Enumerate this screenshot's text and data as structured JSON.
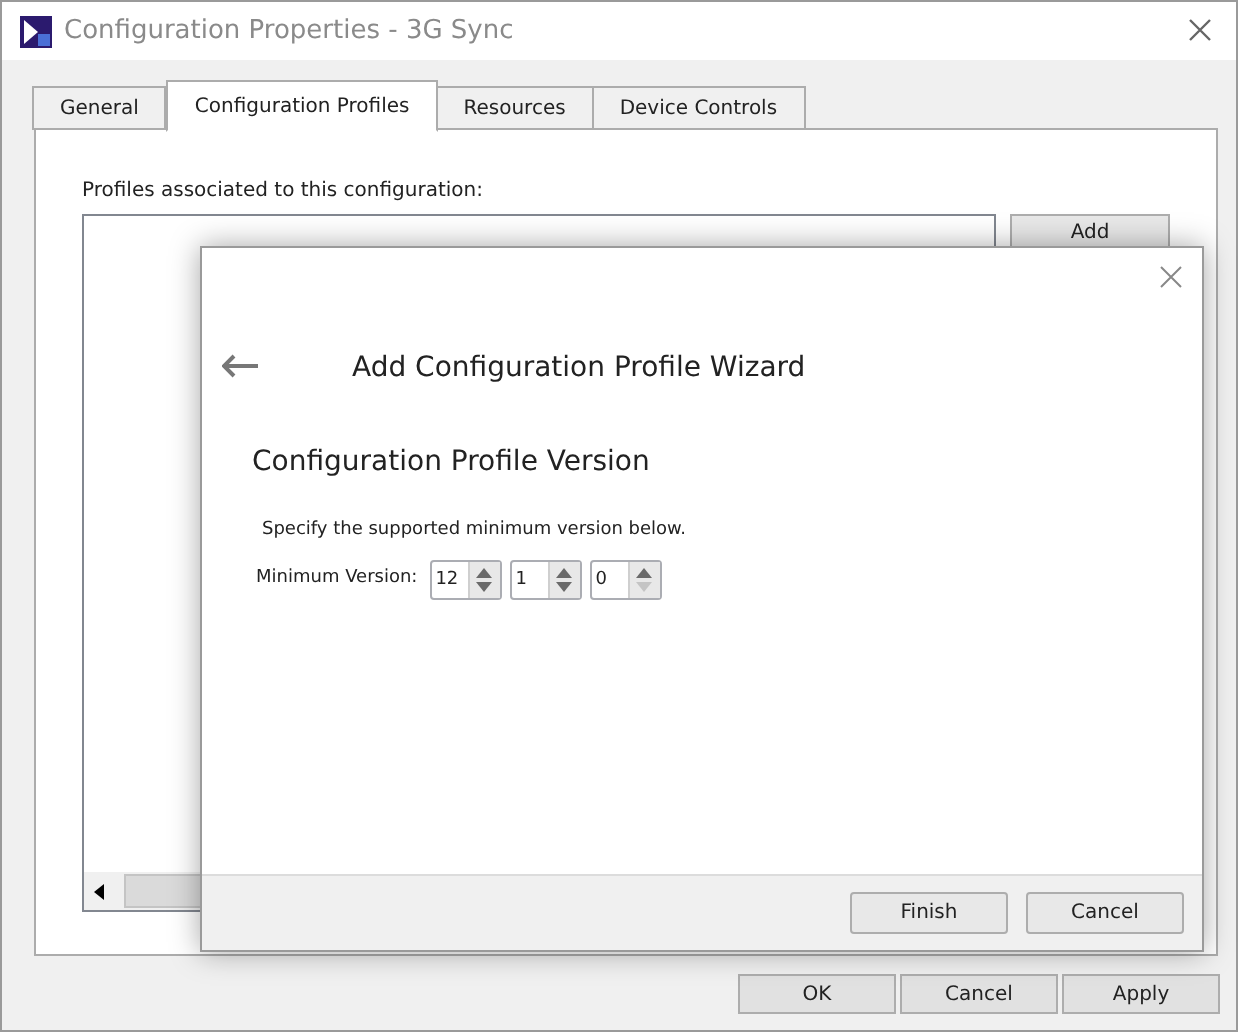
{
  "window": {
    "title": "Configuration Properties - 3G Sync"
  },
  "tabs": [
    {
      "label": "General",
      "selected": false
    },
    {
      "label": "Configuration Profiles",
      "selected": true
    },
    {
      "label": "Resources",
      "selected": false
    },
    {
      "label": "Device Controls",
      "selected": false
    }
  ],
  "profiles": {
    "label": "Profiles associated to this configuration:",
    "add_button": "Add"
  },
  "wizard": {
    "title": "Add Configuration Profile Wizard",
    "heading": "Configuration Profile Version",
    "instruction": "Specify the supported minimum version below.",
    "version_label": "Minimum Version:",
    "spinners": [
      {
        "value": "12",
        "down_disabled": false
      },
      {
        "value": "1",
        "down_disabled": false
      },
      {
        "value": "0",
        "down_disabled": true
      }
    ],
    "buttons": [
      "Finish",
      "Cancel"
    ]
  },
  "buttons": [
    "OK",
    "Cancel",
    "Apply"
  ]
}
